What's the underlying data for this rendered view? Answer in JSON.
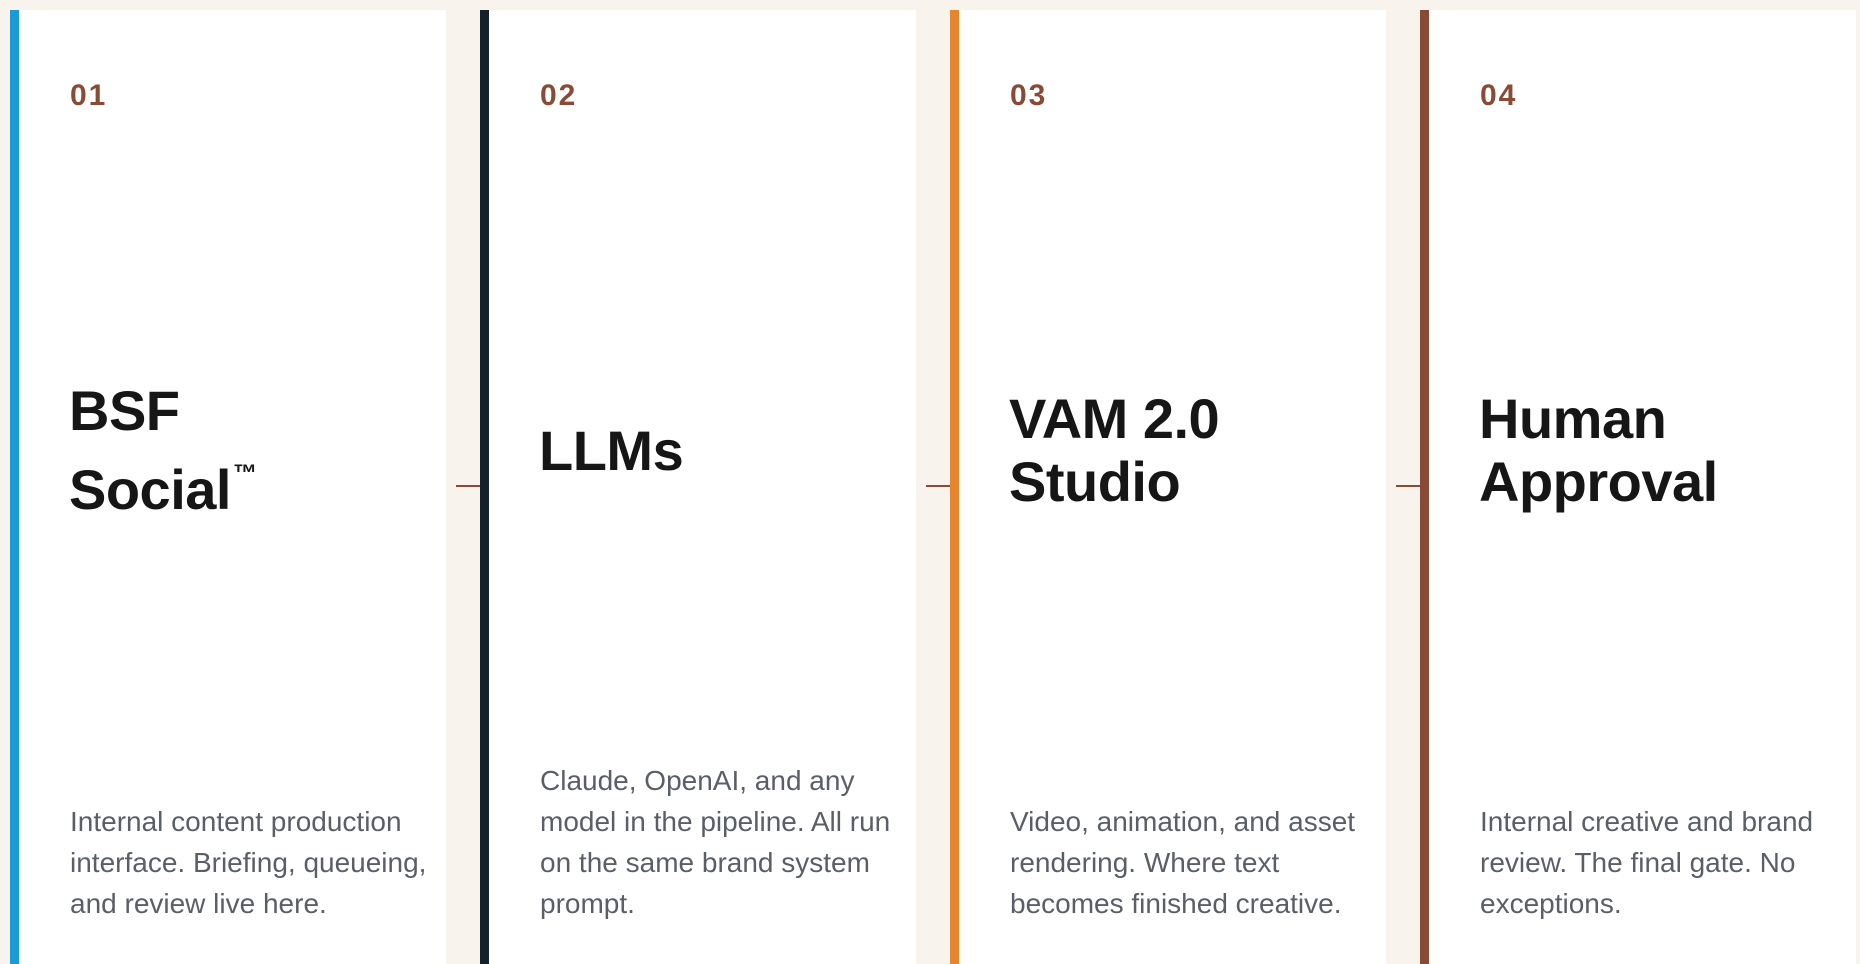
{
  "stages": [
    {
      "number": "01",
      "title_line1": "BSF",
      "title_line2": "Social",
      "title_mark": "™",
      "description": "Internal content production interface. Briefing, queueing, and review live here.",
      "accent": "#1a9ad6"
    },
    {
      "number": "02",
      "title_line1": "LLMs",
      "description": "Claude, OpenAI, and any model in the pipeline. All run on the same brand system prompt.",
      "accent": "#14202b"
    },
    {
      "number": "03",
      "title_line1": "VAM 2.0",
      "title_line2": "Studio",
      "description": "Video, animation, and asset rendering. Where text becomes finished creative.",
      "accent": "#e6852b"
    },
    {
      "number": "04",
      "title_line1": "Human",
      "title_line2": "Approval",
      "description": "Internal creative and brand review. The final gate. No exceptions.",
      "accent": "#8a4b36"
    }
  ],
  "colors": {
    "background": "#f8f3ed",
    "card": "#ffffff",
    "number": "#8a4b36",
    "title": "#161616",
    "body_text": "#5a5f67",
    "arrow": "#8a4b36"
  },
  "icons": {
    "connector": "arrow-right-icon"
  }
}
